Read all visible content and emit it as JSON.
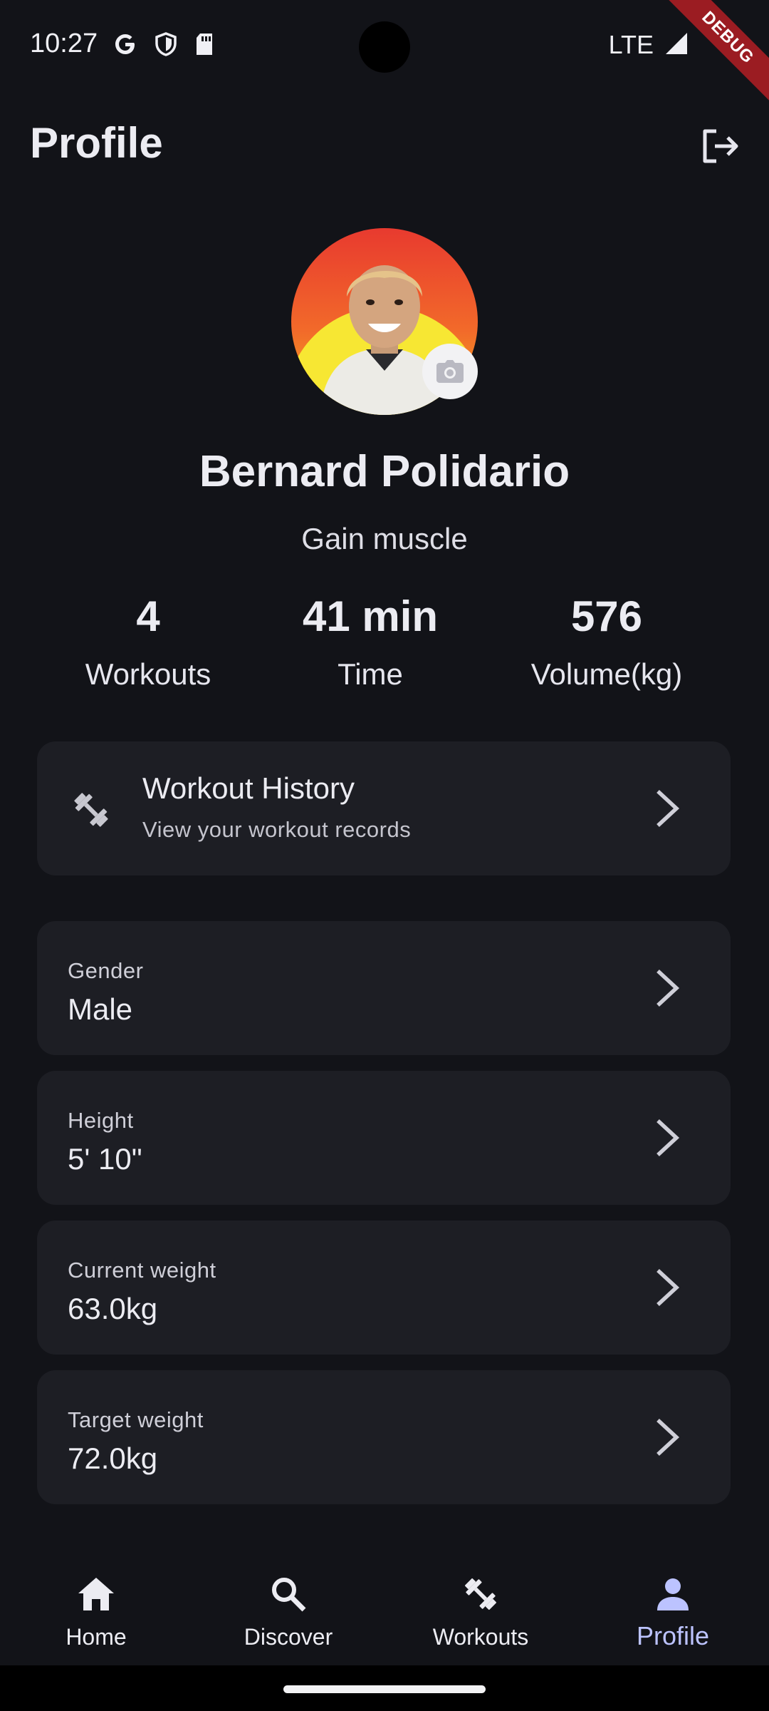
{
  "status_bar": {
    "time": "10:27",
    "network": "LTE",
    "debug_label": "DEBUG",
    "icons": [
      "google-icon",
      "shield-icon",
      "sd-card-icon",
      "signal-icon"
    ]
  },
  "header": {
    "title": "Profile",
    "logout_icon": "logout-icon"
  },
  "profile": {
    "name": "Bernard Polidario",
    "goal": "Gain muscle",
    "avatar_icon": "avatar-photo",
    "camera_icon": "camera-icon"
  },
  "stats": [
    {
      "value": "4",
      "label": "Workouts"
    },
    {
      "value": "41 min",
      "label": "Time"
    },
    {
      "value": "576",
      "label": "Volume(kg)"
    }
  ],
  "history_card": {
    "title": "Workout History",
    "subtitle": "View your workout records",
    "icon": "dumbbell-icon"
  },
  "info_cards": [
    {
      "label": "Gender",
      "value": "Male"
    },
    {
      "label": "Height",
      "value": "5' 10\""
    },
    {
      "label": "Current weight",
      "value": "63.0kg"
    },
    {
      "label": "Target weight",
      "value": "72.0kg"
    }
  ],
  "bottom_nav": {
    "items": [
      {
        "label": "Home",
        "icon": "home-icon"
      },
      {
        "label": "Discover",
        "icon": "search-icon"
      },
      {
        "label": "Workouts",
        "icon": "dumbbell-icon"
      },
      {
        "label": "Profile",
        "icon": "person-icon"
      }
    ],
    "active": "Profile"
  },
  "colors": {
    "background": "#121318",
    "card": "#1d1e24",
    "accent": "#bcc3ff",
    "debug_ribbon": "#9b1c22"
  }
}
